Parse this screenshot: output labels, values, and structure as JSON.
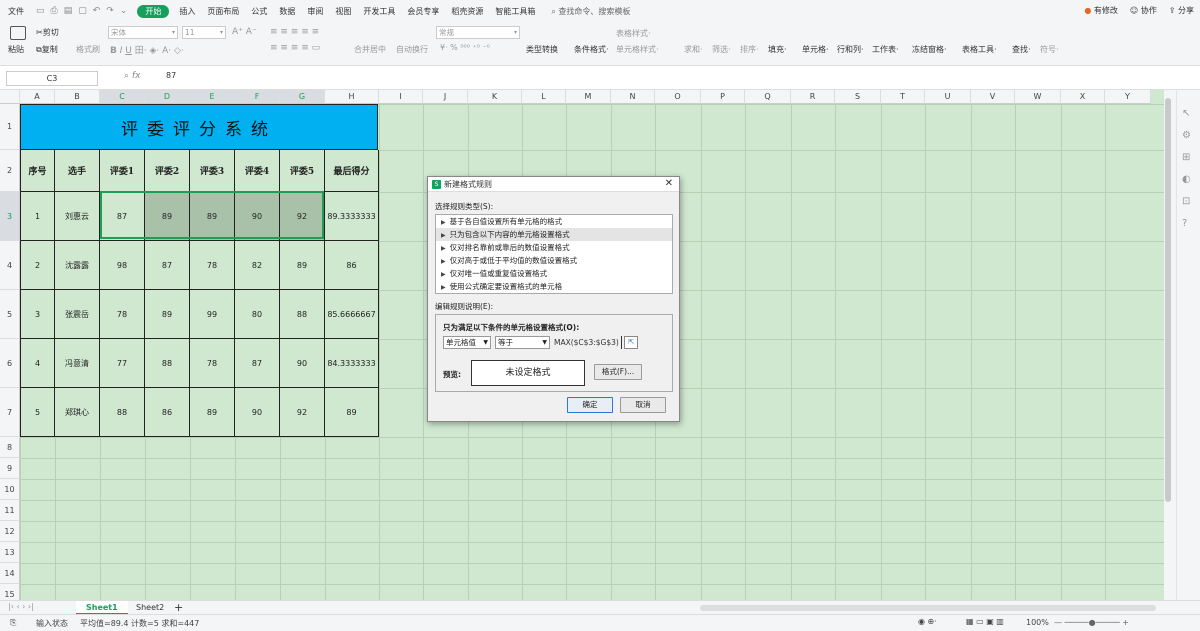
{
  "menu": {
    "file": "文件",
    "tabs": [
      "开始",
      "插入",
      "页面布局",
      "公式",
      "数据",
      "审阅",
      "视图",
      "开发工具",
      "会员专享",
      "稻壳资源",
      "智能工具箱"
    ],
    "active_tab": "开始",
    "search_placeholder": "查找命令、搜索模板",
    "right": {
      "changes": "有修改",
      "collab": "协作",
      "share": "分享"
    }
  },
  "ribbon": {
    "paste": "粘贴",
    "cut": "剪切",
    "copy": "复制",
    "format_painter": "格式刷",
    "font_name": "宋体",
    "font_size": "11",
    "merge": "合并居中",
    "wrap": "自动换行",
    "number_format": "常规",
    "type_convert": "类型转换",
    "cond_format": "条件格式",
    "table_style": "表格样式",
    "cell_style": "单元格样式",
    "sum": "求和",
    "filter": "筛选",
    "sort": "排序",
    "fill": "填充",
    "cell": "单元格",
    "rowcol": "行和列",
    "sheet": "工作表",
    "freeze": "冻结窗格",
    "table_tools": "表格工具",
    "find": "查找",
    "symbol": "符号"
  },
  "formula_bar": {
    "cell_ref": "C3",
    "fx": "fx",
    "value": "87"
  },
  "columns": [
    "A",
    "B",
    "C",
    "D",
    "E",
    "F",
    "G",
    "H",
    "I",
    "J",
    "K",
    "L",
    "M",
    "N",
    "O",
    "P",
    "Q",
    "R",
    "S",
    "T",
    "U",
    "V",
    "W",
    "X",
    "Y"
  ],
  "rows": [
    "1",
    "2",
    "3",
    "4",
    "5",
    "6",
    "7",
    "8",
    "9",
    "10",
    "11",
    "12",
    "13",
    "14",
    "15"
  ],
  "sheet": {
    "title": "评委评分系统",
    "headers": [
      "序号",
      "选手",
      "评委1",
      "评委2",
      "评委3",
      "评委4",
      "评委5",
      "最后得分"
    ],
    "data": [
      [
        "1",
        "刘惠云",
        "87",
        "89",
        "89",
        "90",
        "92",
        "89.3333333"
      ],
      [
        "2",
        "沈露露",
        "98",
        "87",
        "78",
        "82",
        "89",
        "86"
      ],
      [
        "3",
        "张震岳",
        "78",
        "89",
        "99",
        "80",
        "88",
        "85.6666667"
      ],
      [
        "4",
        "冯意清",
        "77",
        "88",
        "78",
        "87",
        "90",
        "84.3333333"
      ],
      [
        "5",
        "郑琪心",
        "88",
        "86",
        "89",
        "90",
        "92",
        "89"
      ]
    ]
  },
  "tabs": {
    "sheet1": "Sheet1",
    "sheet2": "Sheet2",
    "add": "+"
  },
  "status": {
    "mode": "输入状态",
    "summary": "平均值=89.4 计数=5 求和=447",
    "zoom": "100%"
  },
  "dialog": {
    "title": "新建格式规则",
    "select_type_label": "选择规则类型(S):",
    "rule_types": [
      "基于各自值设置所有单元格的格式",
      "只为包含以下内容的单元格设置格式",
      "仅对排名靠前或靠后的数值设置格式",
      "仅对高于或低于平均值的数值设置格式",
      "仅对唯一值或重复值设置格式",
      "使用公式确定要设置格式的单元格"
    ],
    "edit_label": "编辑规则说明(E):",
    "condition_heading": "只为满足以下条件的单元格设置格式(O):",
    "combo1": "单元格值",
    "combo2": "等于",
    "formula": "MAX($C$3:$G$3)",
    "preview_label": "预览:",
    "preview_text": "未设定格式",
    "format_button": "格式(F)...",
    "ok": "确定",
    "cancel": "取消"
  }
}
